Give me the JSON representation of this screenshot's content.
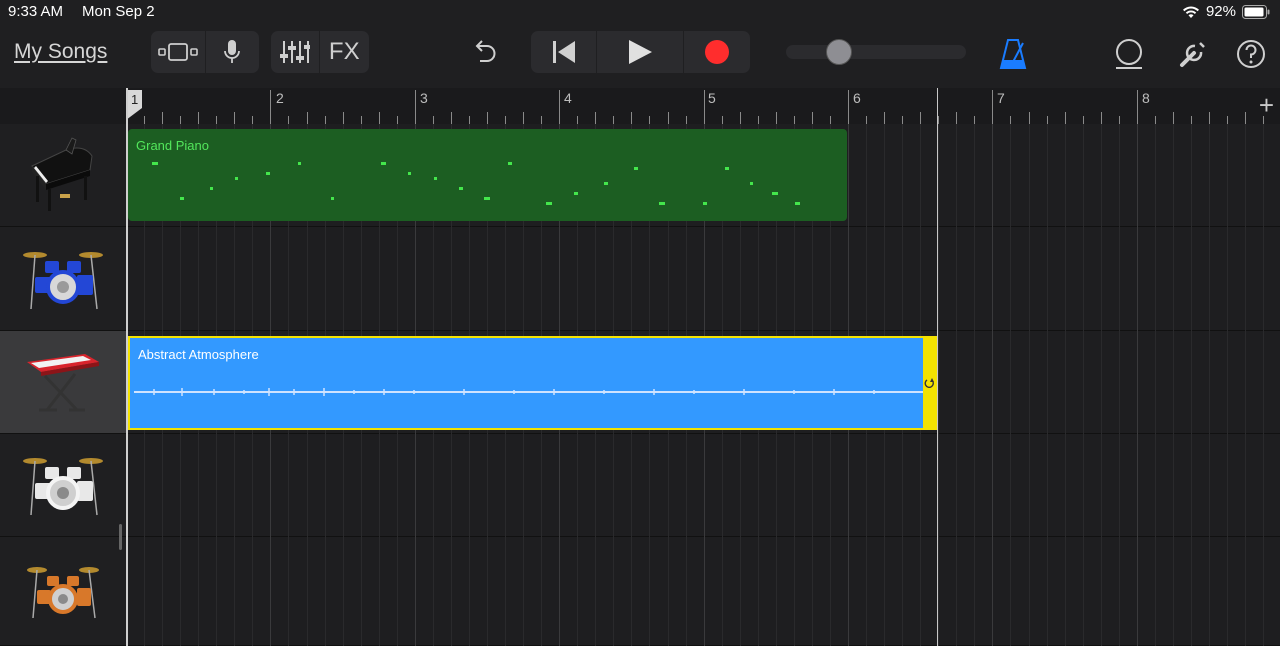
{
  "status": {
    "time": "9:33 AM",
    "date": "Mon Sep 2",
    "battery": "92%"
  },
  "toolbar": {
    "my_songs": "My Songs",
    "fx": "FX",
    "volume_level": 0.26,
    "icons": [
      "browser-icon",
      "microphone-icon",
      "mixer-icon",
      "undo-icon",
      "rewind-icon",
      "play-icon",
      "record-icon",
      "metronome-icon",
      "loop-icon",
      "settings-wrench-icon",
      "help-icon"
    ]
  },
  "ruler": {
    "bars": [
      "1",
      "2",
      "3",
      "4",
      "5",
      "6",
      "7",
      "8"
    ],
    "add_track": "+"
  },
  "tracks": [
    {
      "instrument": "grand-piano",
      "region_label": "Grand Piano",
      "region_color": "#1c5e22"
    },
    {
      "instrument": "drum-kit-blue",
      "region_label": ""
    },
    {
      "instrument": "keyboard-red",
      "region_label": "Abstract Atmosphere",
      "region_color": "#3399ff",
      "selected": true
    },
    {
      "instrument": "drum-kit-white",
      "region_label": ""
    },
    {
      "instrument": "drum-kit-orange",
      "region_label": ""
    }
  ],
  "colors": {
    "accent_blue": "#1a7cff",
    "record_red": "#ff2d2d",
    "selection_yellow": "#f3e200",
    "piano_green": "#1c5e22"
  }
}
